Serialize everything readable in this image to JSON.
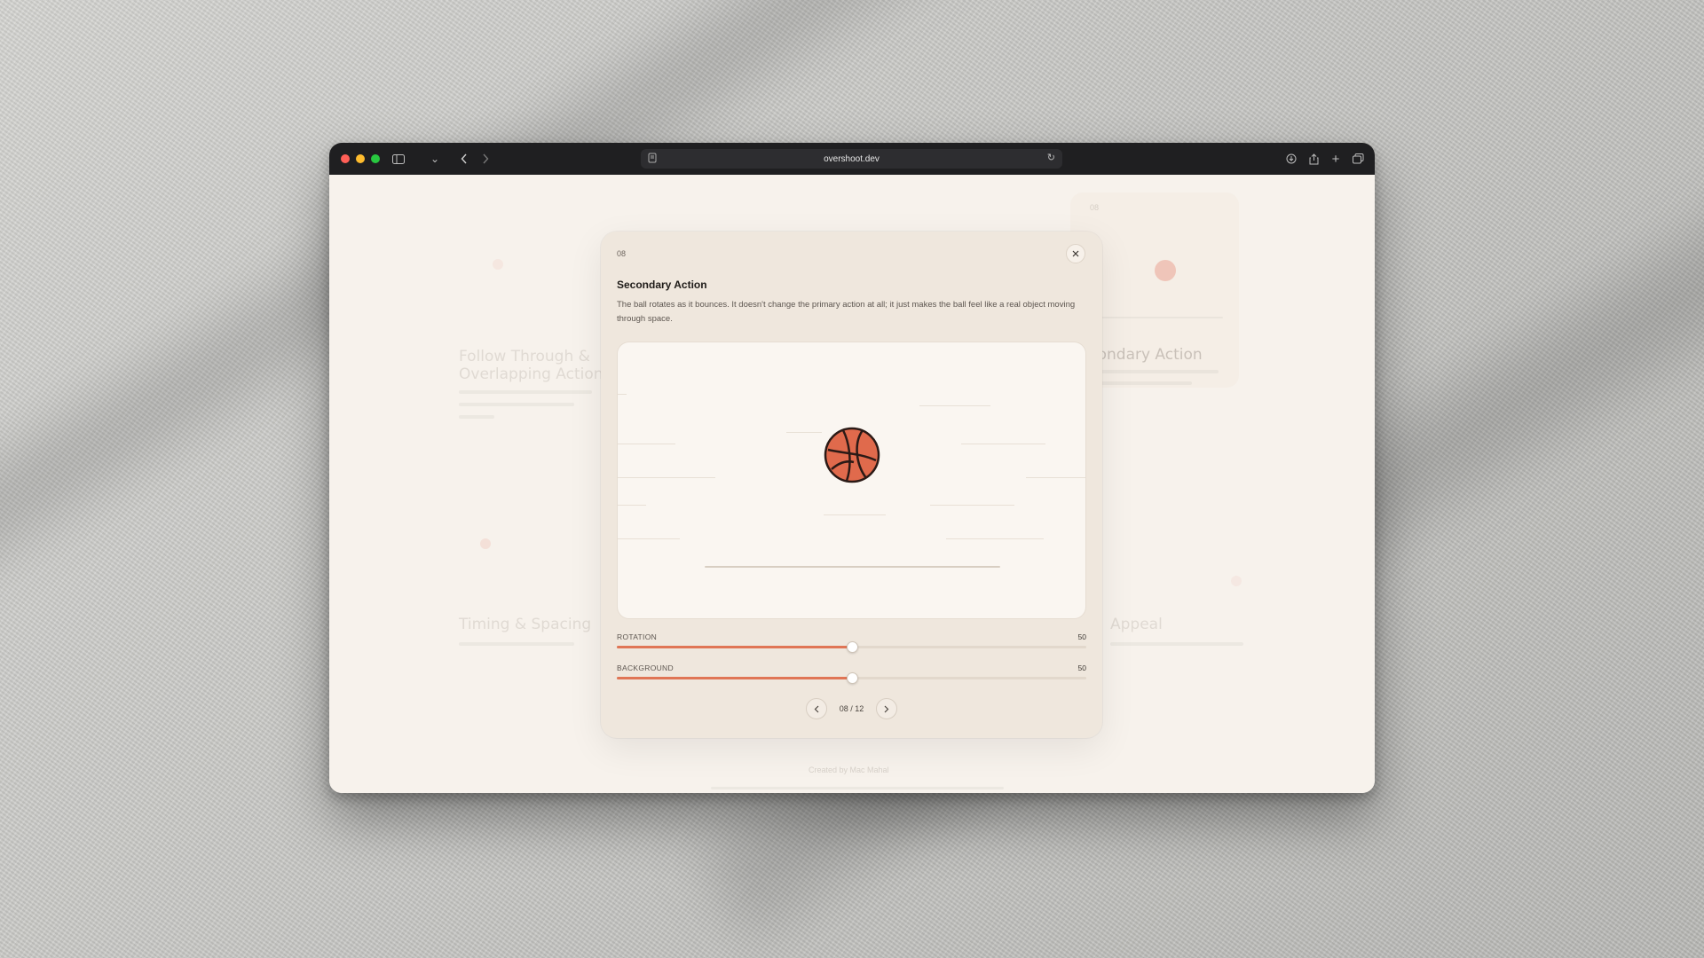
{
  "browser": {
    "url": "overshoot.dev"
  },
  "background_cards": {
    "left_title": "Follow Through & Overlapping Action",
    "right_title": "Secondary Action",
    "bottom_left_title": "Timing & Spacing",
    "bottom_right_title": "Appeal",
    "card_number": "08",
    "footer": "Created by Mac Mahal"
  },
  "modal": {
    "number": "08",
    "title": "Secondary Action",
    "description": "The ball rotates as it bounces. It doesn't change the primary action at all; it just makes the ball feel like a real object moving through space.",
    "close_icon": "close-icon",
    "ball_icon": "basketball-icon",
    "sliders": [
      {
        "label": "ROTATION",
        "value": "50",
        "fraction": 0.5
      },
      {
        "label": "BACKGROUND",
        "value": "50",
        "fraction": 0.5
      }
    ],
    "pager": {
      "text": "08 / 12",
      "prev_icon": "chevron-left-icon",
      "next_icon": "chevron-right-icon"
    }
  },
  "colors": {
    "accent": "#e07555",
    "ball": "#e06a4c",
    "modal_bg": "#efe7dd",
    "page_bg": "#f7f2ec"
  }
}
